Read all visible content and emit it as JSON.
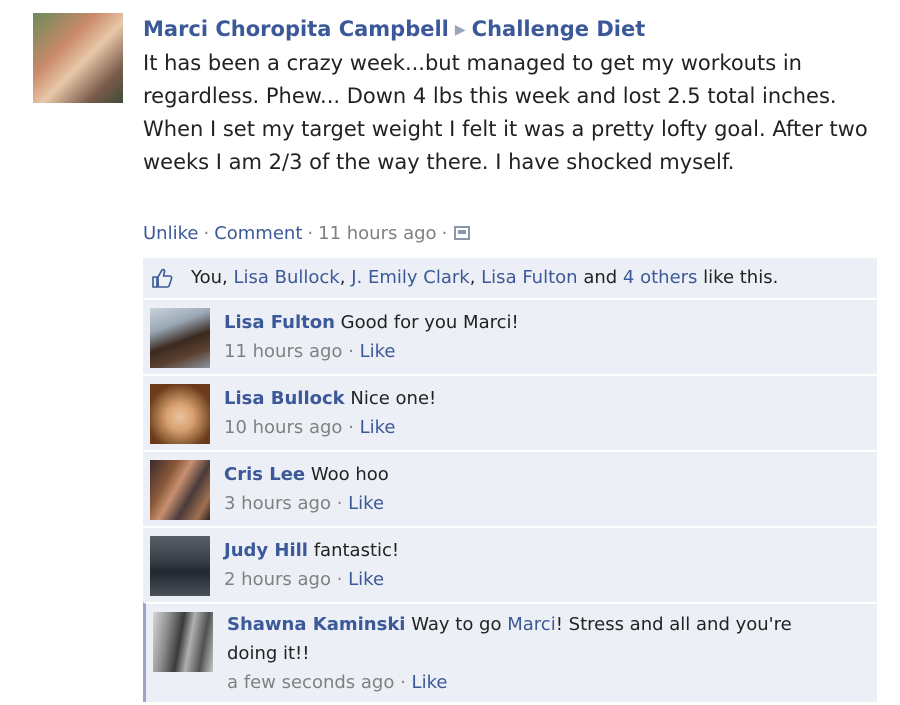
{
  "post": {
    "author": "Marci Choropita Campbell",
    "target": "Challenge Diet",
    "arrow": "▶",
    "body": "It has been a crazy week...but managed to get my workouts in regardless. Phew... Down 4 lbs this week and lost 2.5 total inches. When I set my target weight I felt it was a pretty lofty goal. After two weeks I am 2/3 of the way there. I have shocked myself.",
    "actions": {
      "unlike": "Unlike",
      "sep": "·",
      "comment": "Comment",
      "time": "11 hours ago"
    }
  },
  "likes": {
    "you": "You,",
    "p1": "Lisa Bullock",
    "comma1": ",",
    "p2": "J. Emily Clark",
    "comma2": ",",
    "p3": "Lisa Fulton",
    "and": "and",
    "others": "4 others",
    "suffix": "like this."
  },
  "comments": [
    {
      "name": "Lisa Fulton",
      "text": "Good for you Marci!",
      "time": "11 hours ago",
      "like": "Like"
    },
    {
      "name": "Lisa Bullock",
      "text": "Nice one!",
      "time": "10 hours ago",
      "like": "Like"
    },
    {
      "name": "Cris Lee",
      "text": "Woo hoo",
      "time": "3 hours ago",
      "like": "Like"
    },
    {
      "name": "Judy Hill",
      "text": "fantastic!",
      "time": "2 hours ago",
      "like": "Like"
    },
    {
      "name": "Shawna Kaminski",
      "text_pre": "Way to go ",
      "mention": "Marci",
      "text_post": "! Stress and all and you're doing it!!",
      "time": "a few seconds ago",
      "like": "Like"
    }
  ],
  "colors": {
    "link": "#3b5998",
    "meta": "#808080",
    "comment_bg": "#eceff5"
  }
}
